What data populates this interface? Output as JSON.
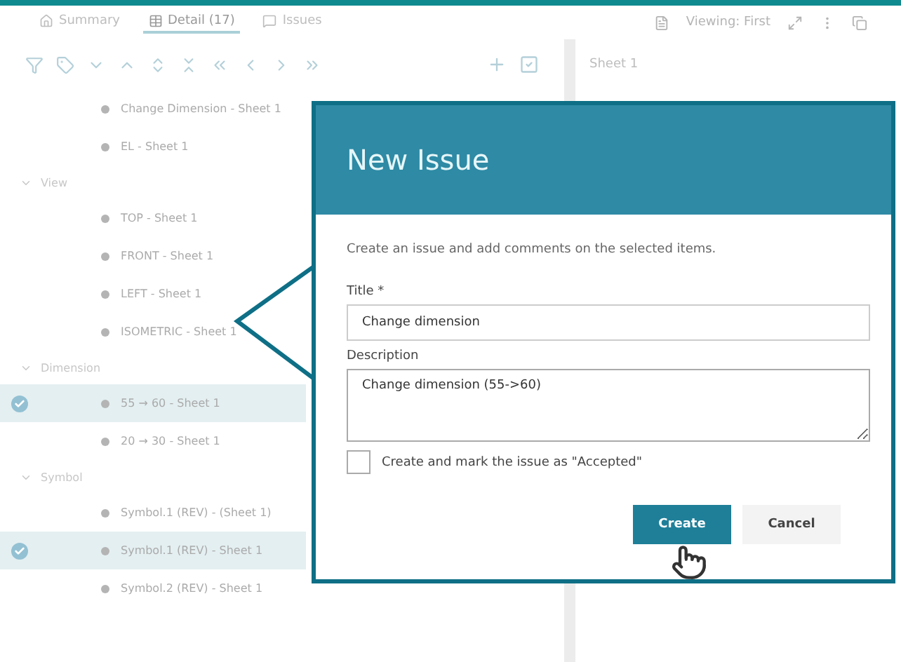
{
  "tabs": [
    {
      "label": "Summary",
      "selected": false
    },
    {
      "label": "Detail (17)",
      "selected": true
    },
    {
      "label": "Issues",
      "selected": false
    }
  ],
  "viewing": "Viewing: First",
  "side_panel": {
    "title": "Sheet 1"
  },
  "tree": [
    {
      "children": [
        {
          "label": "Change Dimension - Sheet 1",
          "selected": false
        },
        {
          "label": "EL - Sheet 1",
          "selected": false
        }
      ]
    },
    {
      "label": "View",
      "expanded": true,
      "children": [
        {
          "label": "TOP - Sheet 1",
          "selected": false
        },
        {
          "label": "FRONT - Sheet 1",
          "selected": false
        },
        {
          "label": "LEFT - Sheet 1",
          "selected": false
        },
        {
          "label": "ISOMETRIC - Sheet 1",
          "selected": false
        }
      ]
    },
    {
      "label": "Dimension",
      "expanded": true,
      "children": [
        {
          "label": "55 → 60 - Sheet 1",
          "selected": true
        },
        {
          "label": "20 → 30 - Sheet 1",
          "selected": false
        }
      ]
    },
    {
      "label": "Symbol",
      "expanded": true,
      "children": [
        {
          "label": "Symbol.1 (REV) - (Sheet 1)",
          "selected": false
        },
        {
          "label": "Symbol.1 (REV) - Sheet 1",
          "selected": true
        },
        {
          "label": "Symbol.2 (REV) - Sheet 1",
          "selected": false
        }
      ]
    }
  ],
  "dialog": {
    "title": "New Issue",
    "intro": "Create an issue and add comments on the selected items.",
    "title_label": "Title *",
    "title_value": "Change dimension",
    "description_label": "Description",
    "description_value": "Change dimension (55->60)",
    "accept_label": "Create and mark the issue as \"Accepted\"",
    "accept_checked": false,
    "buttons": [
      {
        "label": "Create",
        "kind": "primary"
      },
      {
        "label": "Cancel",
        "kind": "secondary"
      }
    ]
  }
}
